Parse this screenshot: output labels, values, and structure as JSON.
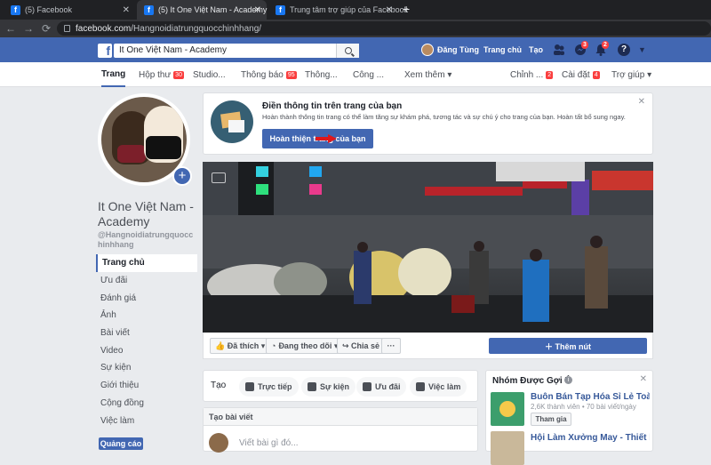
{
  "browser": {
    "tabs": [
      {
        "title": "(5) Facebook",
        "close": "✕"
      },
      {
        "title": "(5) It One Việt Nam - Academy",
        "close": "✕"
      },
      {
        "title": "Trung tâm trợ giúp của Facebook",
        "close": "✕"
      }
    ],
    "new_tab": "+",
    "url_host": "facebook.com",
    "url_path": "/Hangnoidiatrungquocchinhhang/",
    "back": "←",
    "forward": "→",
    "reload": "C"
  },
  "fb": {
    "logo": "f",
    "search_value": "It One Việt Nam - Academy",
    "user_name": "Đăng Tùng",
    "home": "Trang chủ",
    "create": "Tạo",
    "messages_count": "3",
    "notifications_count": "2",
    "help": "?"
  },
  "page_nav": {
    "items": [
      {
        "label": "Trang",
        "badge": ""
      },
      {
        "label": "Hộp thư",
        "badge": "30"
      },
      {
        "label": "Studio...",
        "badge": ""
      },
      {
        "label": "Thông báo",
        "badge": "95"
      },
      {
        "label": "Thông...",
        "badge": ""
      },
      {
        "label": "Công ...",
        "badge": ""
      },
      {
        "label": "Xem thêm ▾",
        "badge": ""
      },
      {
        "label": "Chỉnh ...",
        "badge": "2"
      },
      {
        "label": "Cài đặt",
        "badge": "4"
      },
      {
        "label": "Trợ giúp ▾",
        "badge": ""
      }
    ]
  },
  "profile": {
    "name": "It One Việt Nam - Academy",
    "username": "@Hangnoidiatrungquocchinhhang",
    "add": "+"
  },
  "left_nav": [
    "Trang chủ",
    "Ưu đãi",
    "Đánh giá",
    "Ảnh",
    "Bài viết",
    "Video",
    "Sự kiện",
    "Giới thiệu",
    "Cộng đồng",
    "Việc làm"
  ],
  "ads_button": "Quảng cáo",
  "promo": {
    "title": "Điền thông tin trên trang của bạn",
    "desc": "Hoàn thành thông tin trang có thể làm tăng sự khám phá, tương tác và sự chú ý cho trang của bạn. Hoàn tất bổ sung ngay.",
    "button": "Hoàn thiện trang của bạn",
    "close": "✕"
  },
  "actions": {
    "like": "👍 Đã thích ▾",
    "follow": "Đang theo dõi ▾",
    "share": "↪ Chia sẻ",
    "more": "···",
    "add_button": "＋ Thêm nút"
  },
  "create": {
    "label": "Tạo",
    "buttons": [
      "Trực tiếp",
      "Sự kiện",
      "Ưu đãi",
      "Việc làm"
    ]
  },
  "post": {
    "header": "Tạo bài viết",
    "placeholder": "Viết bài gì đó..."
  },
  "groups": {
    "title": "Nhóm Được Gợi Ý",
    "info": "i",
    "close": "✕",
    "items": [
      {
        "name": "Buôn Bán Tạp Hóa Sỉ Lẻ Toà...",
        "meta": "2,6K thành viên • 70 bài viết/ngày",
        "join": "Tham gia"
      },
      {
        "name": "Hội Làm Xưởng May - Thiết k...",
        "meta": "",
        "join": ""
      }
    ]
  }
}
